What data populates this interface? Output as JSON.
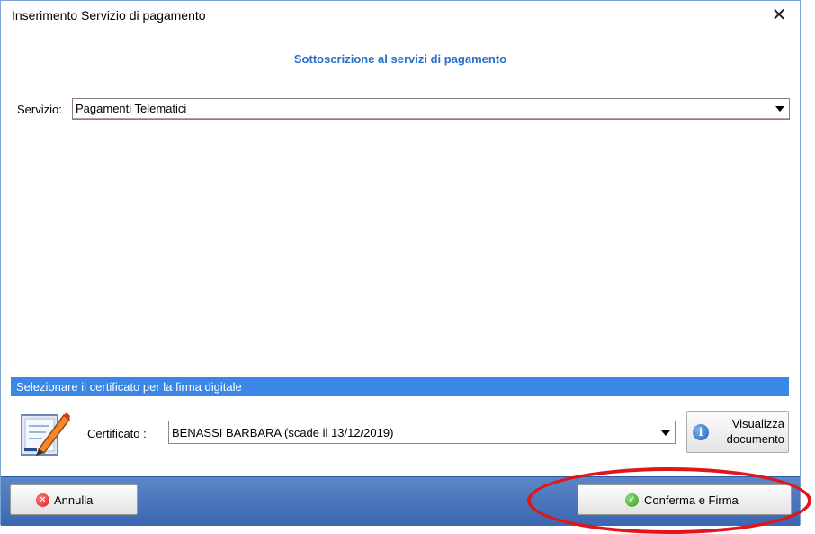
{
  "window": {
    "title": "Inserimento Servizio di pagamento",
    "close_glyph": "✕"
  },
  "header": {
    "subtitle": "Sottoscrizione al servizi di pagamento"
  },
  "servizio": {
    "label": "Servizio:",
    "selected": "Pagamenti Telematici"
  },
  "firma": {
    "section_title": "Selezionare il certificato per la firma digitale",
    "cert_icon": "certificate-signing-icon",
    "certificato_label": "Certificato :",
    "certificato_selected": "BENASSI BARBARA (scade il 13/12/2019)",
    "visualizza_line1": "Visualizza",
    "visualizza_line2": "documento",
    "visualizza_icon": "info-icon"
  },
  "footer": {
    "annulla_label": "Annulla",
    "annulla_icon": "cancel-icon",
    "conferma_label": "Conferma e Firma",
    "conferma_icon": "check-icon"
  },
  "colors": {
    "accent": "#2a6fc9",
    "section_bar": "#3b87e6",
    "footer_bar": "#4a77bd",
    "annotation": "#e0161b"
  }
}
